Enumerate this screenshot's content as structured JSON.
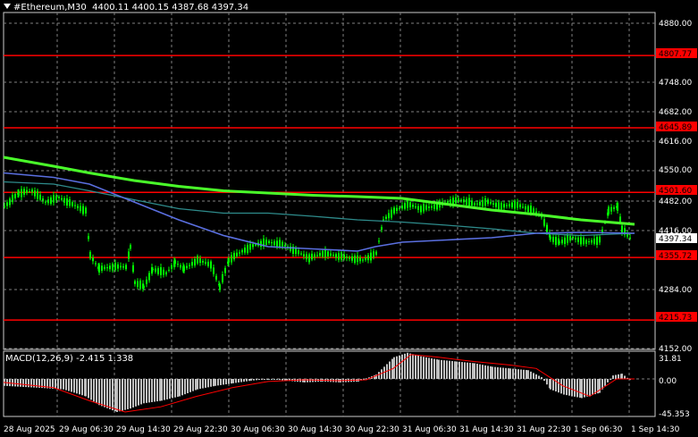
{
  "header": {
    "symbol": "#Ethereum,M30",
    "ohlc": "4400.11 4400.15 4387.68 4397.34"
  },
  "price_axis": {
    "ticks": [
      "4880.00",
      "4748.00",
      "4682.00",
      "4616.00",
      "4550.00",
      "4482.00",
      "4416.00",
      "4284.00",
      "4152.00"
    ]
  },
  "levels": [
    {
      "label": "4807.77",
      "value": 4807.77
    },
    {
      "label": "4645.89",
      "value": 4645.89
    },
    {
      "label": "4501.60",
      "value": 4501.6
    },
    {
      "label": "4355.72",
      "value": 4355.72
    },
    {
      "label": "4215.73",
      "value": 4215.73
    }
  ],
  "current_price": {
    "label": "4397.34",
    "value": 4397.34
  },
  "macd": {
    "label": "MACD(12,26,9) -2.415 1.338",
    "ticks": [
      "31.81",
      "0.00",
      "-45.353"
    ]
  },
  "time_axis": {
    "labels": [
      "28 Aug 2025",
      "29 Aug 06:30",
      "29 Aug 14:30",
      "29 Aug 22:30",
      "30 Aug 06:30",
      "30 Aug 14:30",
      "30 Aug 22:30",
      "31 Aug 06:30",
      "31 Aug 14:30",
      "31 Aug 22:30",
      "1 Sep 06:30",
      "1 Sep 14:30"
    ]
  },
  "colors": {
    "background": "#000000",
    "grid": "#7f7f7f",
    "candle": "#00ff00",
    "level": "#ff0000",
    "ma_slow": "#4aff2a",
    "ma_mid": "#5a6fe0",
    "ma_fast": "#2e8b8b",
    "macd_hist": "#c0c0c0",
    "macd_signal": "#ff0000"
  }
}
